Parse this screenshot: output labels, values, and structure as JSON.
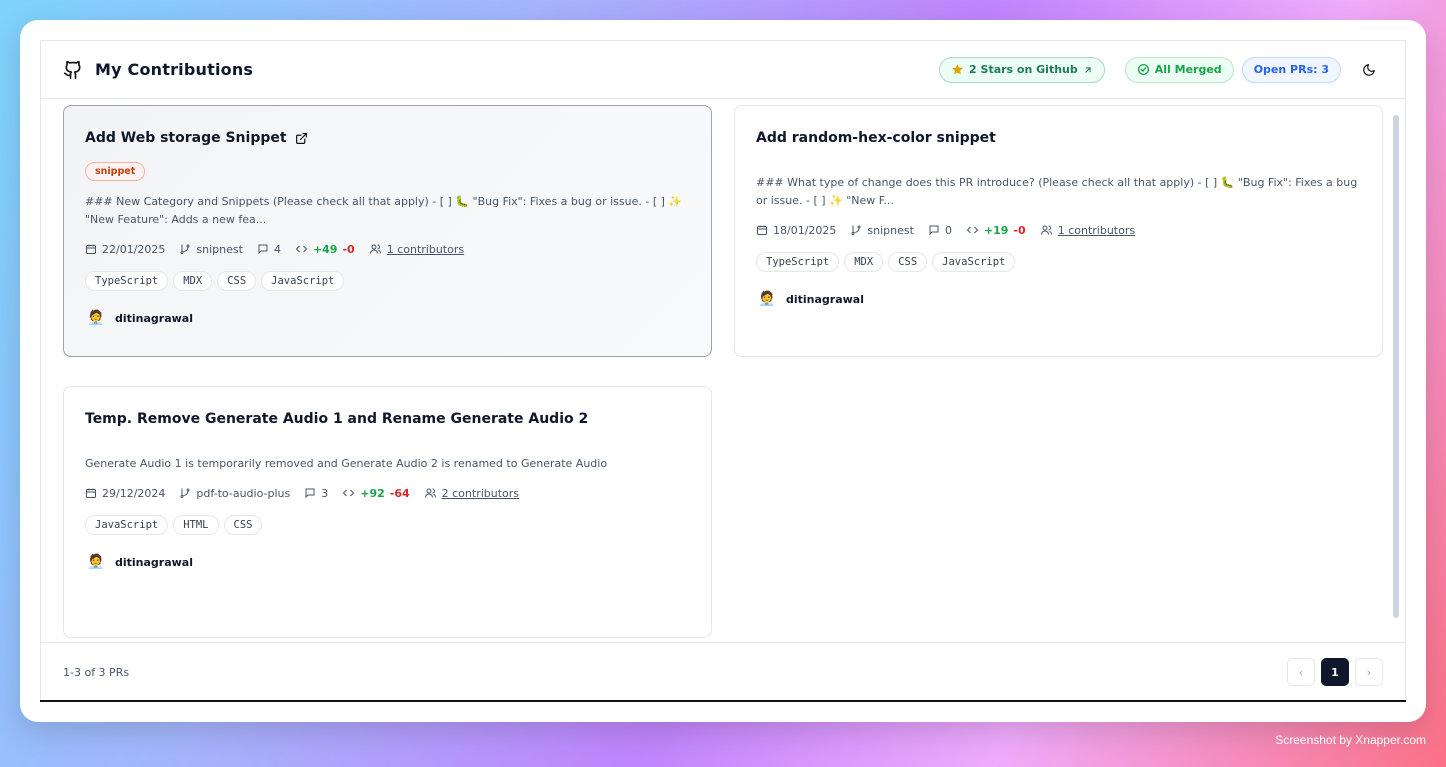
{
  "header": {
    "title": "My Contributions",
    "stars_label": "2 Stars on Github",
    "merged_label": "All Merged",
    "open_prs_label": "Open PRs: 3"
  },
  "prs": [
    {
      "title": "Add Web storage Snippet",
      "badge": "snippet",
      "description": "### New Category and Snippets (Please check all that apply) - [ ] 🐛 \"Bug Fix\": Fixes a bug or issue. - [ ] ✨ \"New Feature\": Adds a new fea...",
      "date": "22/01/2025",
      "repo": "snipnest",
      "comments": "4",
      "additions": "+49",
      "deletions": "-0",
      "contributors": "1 contributors",
      "tags": [
        "TypeScript",
        "MDX",
        "CSS",
        "JavaScript"
      ],
      "author": "ditinagrawal"
    },
    {
      "title": "Add random-hex-color snippet",
      "description": "### What type of change does this PR introduce? (Please check all that apply) - [ ] 🐛 \"Bug Fix\": Fixes a bug or issue. - [ ] ✨ \"New F...",
      "date": "18/01/2025",
      "repo": "snipnest",
      "comments": "0",
      "additions": "+19",
      "deletions": "-0",
      "contributors": "1 contributors",
      "tags": [
        "TypeScript",
        "MDX",
        "CSS",
        "JavaScript"
      ],
      "author": "ditinagrawal"
    },
    {
      "title": "Temp. Remove Generate Audio 1 and Rename Generate Audio 2",
      "description": "Generate Audio 1 is temporarily removed and Generate Audio 2 is renamed to Generate Audio",
      "date": "29/12/2024",
      "repo": "pdf-to-audio-plus",
      "comments": "3",
      "additions": "+92",
      "deletions": "-64",
      "contributors": "2 contributors",
      "tags": [
        "JavaScript",
        "HTML",
        "CSS"
      ],
      "author": "ditinagrawal"
    }
  ],
  "footer": {
    "summary": "1-3 of 3 PRs",
    "current_page": "1",
    "prev": "‹",
    "next": "›"
  },
  "credit": "Screenshot by Xnapper.com",
  "colors": {
    "additions": "#16a34a",
    "deletions": "#dc2626",
    "badge": "#c2410c",
    "merged": "#16a34a",
    "open": "#2563eb"
  }
}
